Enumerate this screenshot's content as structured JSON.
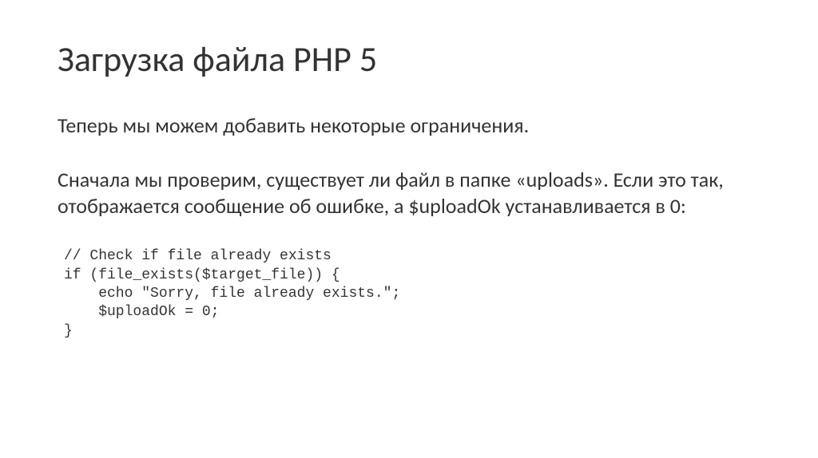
{
  "slide": {
    "title": "Загрузка файла PHP 5",
    "paragraph1": "Теперь мы можем добавить некоторые ограничения.",
    "paragraph2": "Сначала мы проверим, существует ли файл в папке «uploads». Если это так, отображается сообщение об ошибке, а $uploadOk устанавливается в 0:",
    "code": "// Check if file already exists\nif (file_exists($target_file)) {\n    echo \"Sorry, file already exists.\";\n    $uploadOk = 0;\n}"
  }
}
